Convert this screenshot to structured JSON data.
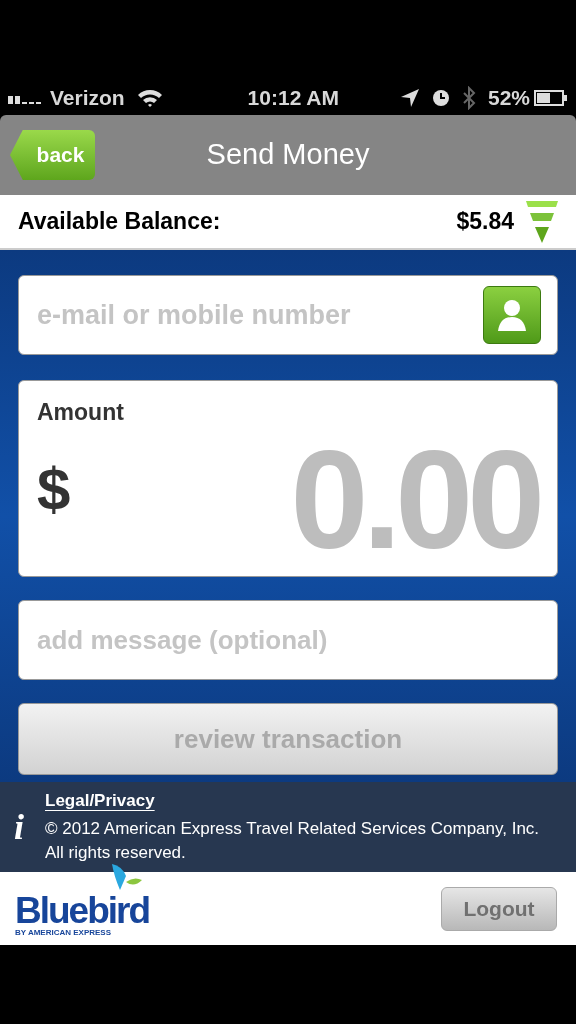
{
  "status_bar": {
    "carrier": "Verizon",
    "time": "10:12 AM",
    "battery": "52%"
  },
  "nav": {
    "back": "back",
    "title": "Send Money"
  },
  "balance": {
    "label": "Available Balance:",
    "value": "$5.84"
  },
  "recipient": {
    "placeholder": "e-mail or mobile number"
  },
  "amount": {
    "label": "Amount",
    "currency": "$",
    "value": "0.00"
  },
  "message": {
    "placeholder": "add message (optional)"
  },
  "review_button": {
    "label": "review transaction",
    "disabled": true
  },
  "footer": {
    "info_glyph": "i",
    "link": "Legal/Privacy",
    "copyright": "© 2012 American Express Travel Related Services Company, Inc.",
    "rights": "All rights reserved."
  },
  "logo": {
    "name": "Bluebird",
    "tagline": "BY AMERICAN EXPRESS"
  },
  "logout": "Logout"
}
